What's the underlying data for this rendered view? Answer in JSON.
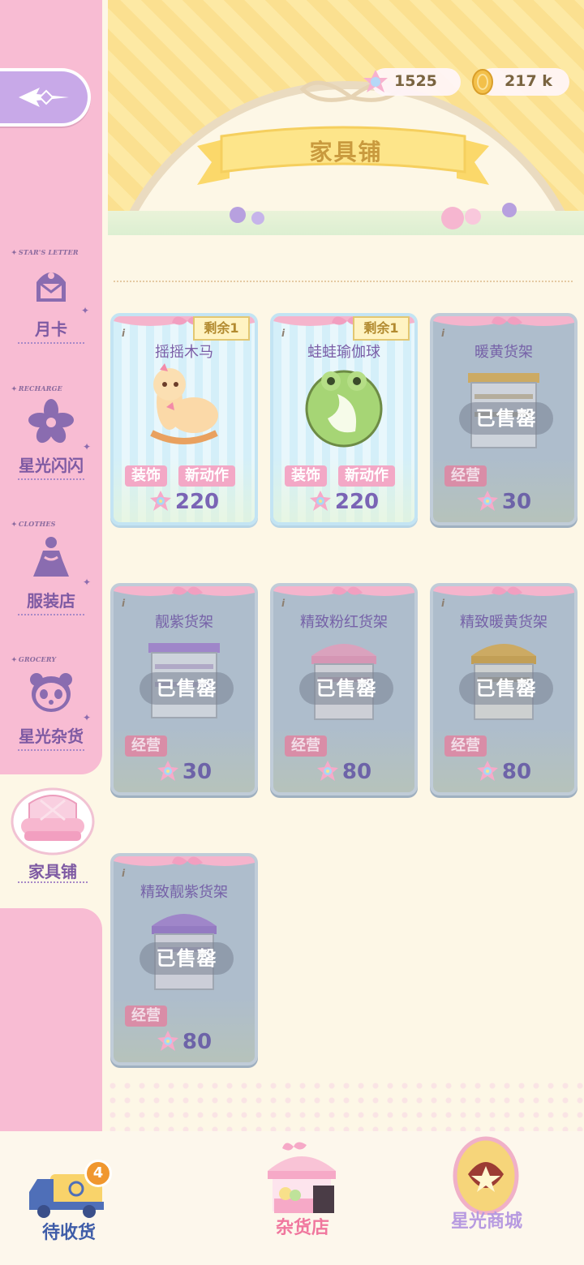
{
  "header": {
    "title": "家具铺",
    "currency": [
      {
        "icon": "starlight-gem-icon",
        "value": "1525"
      },
      {
        "icon": "gold-coin-icon",
        "value": "217 k"
      }
    ]
  },
  "sidebar": {
    "back_icon": "back-arrow-icon",
    "items": [
      {
        "tag": "STAR'S LETTER",
        "label": "月卡",
        "icon": "letter-icon"
      },
      {
        "tag": "RECHARGE",
        "label": "星光闪闪",
        "icon": "star-flower-icon"
      },
      {
        "tag": "CLOTHES",
        "label": "服装店",
        "icon": "dress-icon"
      },
      {
        "tag": "GROCERY",
        "label": "星光杂货",
        "icon": "panda-icon"
      }
    ],
    "active": {
      "label": "家具铺",
      "icon": "sofa-icon"
    }
  },
  "cards": [
    {
      "name": "摇摇木马",
      "remain": "剩余1",
      "tags": [
        "装饰",
        "新动作"
      ],
      "price": "220",
      "sold": false,
      "art": "alpaca-rocking-horse"
    },
    {
      "name": "蛙蛙瑜伽球",
      "remain": "剩余1",
      "tags": [
        "装饰",
        "新动作"
      ],
      "price": "220",
      "sold": false,
      "art": "frog-yoga-ball"
    },
    {
      "name": "暖黄货架",
      "remain": "",
      "tags": [
        "经营"
      ],
      "price": "30",
      "sold": true,
      "sold_label": "已售罄",
      "art": "yellow-shelf"
    },
    {
      "name": "靓紫货架",
      "remain": "",
      "tags": [
        "经营"
      ],
      "price": "30",
      "sold": true,
      "sold_label": "已售罄",
      "art": "purple-shelf"
    },
    {
      "name": "精致粉红货架",
      "remain": "",
      "tags": [
        "经营"
      ],
      "price": "80",
      "sold": true,
      "sold_label": "已售罄",
      "art": "pink-awning-shelf"
    },
    {
      "name": "精致暖黄货架",
      "remain": "",
      "tags": [
        "经营"
      ],
      "price": "80",
      "sold": true,
      "sold_label": "已售罄",
      "art": "yellow-awning-shelf"
    },
    {
      "name": "精致靓紫货架",
      "remain": "",
      "tags": [
        "经营"
      ],
      "price": "80",
      "sold": true,
      "sold_label": "已售罄",
      "art": "purple-awning-shelf"
    }
  ],
  "bottom_bar": {
    "delivery": {
      "label": "待收货",
      "badge": "4",
      "icon": "delivery-truck-icon"
    },
    "grocery": {
      "label": "杂货店",
      "icon": "grocery-stall-icon"
    },
    "mall": {
      "label": "星光商城",
      "icon": "starlight-egg-icon"
    }
  },
  "colors": {
    "sidebar": "#f8bcd3",
    "accent_purple": "#7e5aa3",
    "price_purple": "#7a64b5",
    "tag_pink": "#f3a8c6",
    "badge_orange": "#f0972f"
  }
}
